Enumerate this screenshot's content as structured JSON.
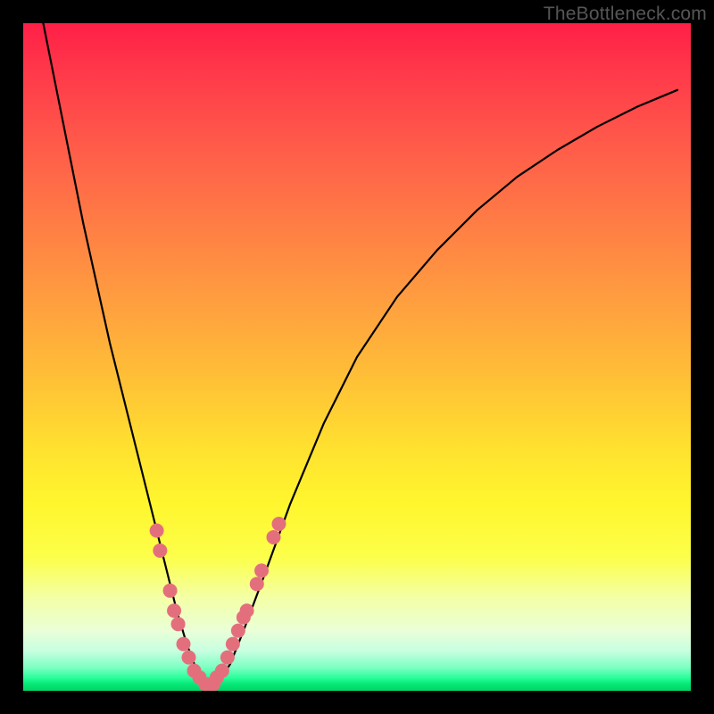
{
  "watermark": "TheBottleneck.com",
  "chart_data": {
    "type": "line",
    "title": "",
    "xlabel": "",
    "ylabel": "",
    "xlim": [
      0,
      100
    ],
    "ylim": [
      0,
      100
    ],
    "grid": false,
    "legend": false,
    "series": [
      {
        "name": "bottleneck-curve",
        "x": [
          3,
          5,
          7,
          9,
          11,
          13,
          15,
          17,
          18.5,
          20,
          21.5,
          23,
          24.5,
          26,
          27.5,
          29,
          31,
          33,
          36,
          40,
          45,
          50,
          56,
          62,
          68,
          74,
          80,
          86,
          92,
          98
        ],
        "y": [
          100,
          90,
          80,
          70,
          61,
          52,
          44,
          36,
          30,
          24,
          18,
          12,
          7,
          3,
          1,
          1,
          4,
          9,
          17,
          28,
          40,
          50,
          59,
          66,
          72,
          77,
          81,
          84.5,
          87.5,
          90
        ]
      }
    ],
    "markers": {
      "name": "highlight-dots",
      "color": "#e46f7c",
      "radius_px": 8,
      "points": [
        {
          "x": 20.0,
          "y": 24
        },
        {
          "x": 20.5,
          "y": 21
        },
        {
          "x": 22.0,
          "y": 15
        },
        {
          "x": 22.6,
          "y": 12
        },
        {
          "x": 23.2,
          "y": 10
        },
        {
          "x": 24.0,
          "y": 7
        },
        {
          "x": 24.8,
          "y": 5
        },
        {
          "x": 25.6,
          "y": 3
        },
        {
          "x": 26.4,
          "y": 2
        },
        {
          "x": 27.3,
          "y": 1
        },
        {
          "x": 28.2,
          "y": 1
        },
        {
          "x": 28.5,
          "y": 1
        },
        {
          "x": 29.0,
          "y": 2
        },
        {
          "x": 29.8,
          "y": 3
        },
        {
          "x": 30.6,
          "y": 5
        },
        {
          "x": 31.4,
          "y": 7
        },
        {
          "x": 32.2,
          "y": 9
        },
        {
          "x": 33.0,
          "y": 11
        },
        {
          "x": 33.5,
          "y": 12
        },
        {
          "x": 35.0,
          "y": 16
        },
        {
          "x": 35.7,
          "y": 18
        },
        {
          "x": 37.5,
          "y": 23
        },
        {
          "x": 38.3,
          "y": 25
        }
      ]
    }
  }
}
